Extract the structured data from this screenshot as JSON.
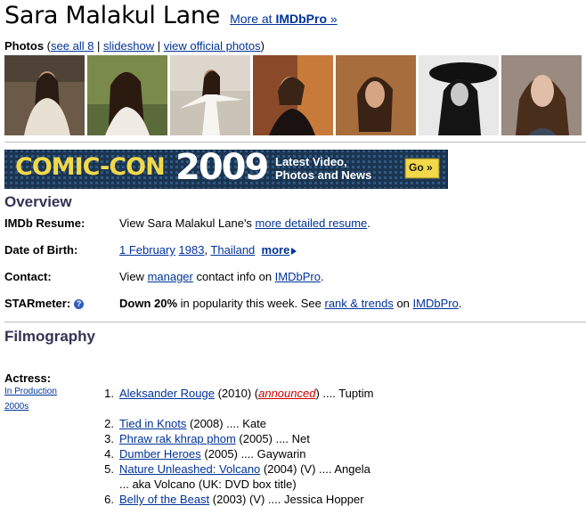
{
  "header": {
    "name": "Sara Malakul Lane",
    "pro_link_prefix": "More at ",
    "pro_link_brand": "IMDbPro",
    "pro_link_suffix": " »"
  },
  "photos": {
    "label": "Photos",
    "open_paren": " (",
    "see_all": "see all 8",
    "sep": " | ",
    "slideshow": "slideshow",
    "view_official": "view official photos",
    "close_paren": ")",
    "thumbnails": [
      {
        "tone": "#6b5a48"
      },
      {
        "tone": "#7a8a4a"
      },
      {
        "tone": "#c9c3b8"
      },
      {
        "tone": "#8a4a2a"
      },
      {
        "tone": "#9a6238"
      },
      {
        "tone": "#1a1a1a"
      },
      {
        "tone": "#b89a86"
      }
    ]
  },
  "banner": {
    "comic_con": "COMIC-CON",
    "year": "2009",
    "line1": "Latest Video,",
    "line2": "Photos and News",
    "go": "Go »",
    "colors": {
      "bg": "#1b3450",
      "yellow": "#f2d84a",
      "text": "#ffffff"
    }
  },
  "overview": {
    "heading": "Overview",
    "resume_label": "IMDb Resume:",
    "resume_prefix": "View Sara Malakul Lane's ",
    "resume_link": "more detailed resume",
    "resume_suffix": ".",
    "dob_label": "Date of Birth:",
    "dob_day": "1 February",
    "dob_year": "1983",
    "dob_sep": ", ",
    "dob_place": "Thailand",
    "dob_more": "more",
    "contact_label": "Contact:",
    "contact_prefix": "View ",
    "contact_link": "manager",
    "contact_mid": " contact info on ",
    "contact_pro": "IMDbPro",
    "contact_suffix": ".",
    "starmeter_label": "STARmeter:",
    "starmeter_down": "Down 20%",
    "starmeter_mid": " in popularity this week. See ",
    "starmeter_link": "rank & trends",
    "starmeter_on": " on ",
    "starmeter_pro": "IMDbPro",
    "starmeter_suffix": "."
  },
  "filmography": {
    "heading": "Filmography",
    "actress_label": "Actress:",
    "in_production": "In Production",
    "decade": "2000s",
    "films": [
      {
        "num": "1.",
        "title": "Aleksander Rouge",
        "year": " (2010) (",
        "announced": "announced",
        "after": ") .... Tuptim"
      },
      {
        "num": "2.",
        "title": "Tied in Knots",
        "year": " (2008) .... Kate"
      },
      {
        "num": "3.",
        "title": "Phraw rak khrap phom",
        "year": " (2005) .... Net"
      },
      {
        "num": "4.",
        "title": "Dumber Heroes",
        "year": " (2005) .... Gaywarin"
      },
      {
        "num": "5.",
        "title": "Nature Unleashed: Volcano",
        "year": " (2004) (V) .... Angela"
      },
      {
        "num": "6.",
        "title": "Belly of the Beast",
        "year": " (2003) (V) .... Jessica Hopper"
      }
    ],
    "aka_5": "... aka Volcano (UK: DVD box title)"
  }
}
